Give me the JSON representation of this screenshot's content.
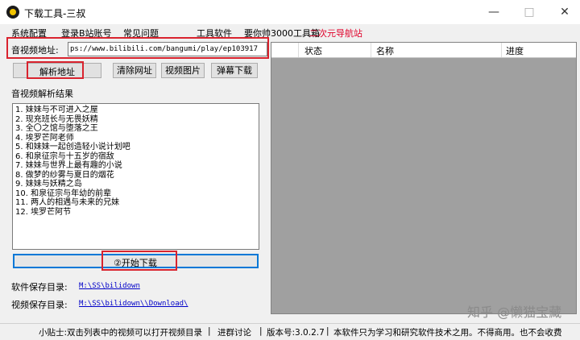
{
  "window": {
    "title": "下载工具-三叔",
    "minimize": "—",
    "maximize": "□",
    "close": "✕"
  },
  "menu": [
    "系统配置",
    "登录B站账号",
    "常见问题",
    "工具软件",
    "要你帅3000工具箱",
    "二次元导航站"
  ],
  "url_label": "音视频地址:",
  "url_value": "ps://www.bilibili.com/bangumi/play/ep103917",
  "buttons": {
    "parse": "解析地址",
    "clear": "清除网址",
    "video_pic": "视频图片",
    "danmaku": "弹幕下载",
    "start": "②开始下载"
  },
  "results_label": "音视频解析结果",
  "results": [
    "1. 妹妹与不可进入之屋",
    "2. 现充班长与无畏妖精",
    "3. 全〇之馆与堕落之王",
    "4. 埃罗芒阿老师",
    "5. 和妹妹一起创造轻小说计划吧",
    "6. 和泉征宗与十五岁的宿敌",
    "7. 妹妹与世界上最有趣的小说",
    "8. 做梦的纱雾与夏日的烟花",
    "9. 妹妹与妖精之岛",
    "10. 和泉征宗与年幼的前辈",
    "11. 两人的相遇与未来的兄妹",
    "12. 埃罗芒阿节"
  ],
  "table_headers": [
    "状态",
    "名称",
    "进度"
  ],
  "software_dir_label": "软件保存目录:",
  "software_dir_value": "M:\\SS\\bilidown",
  "video_dir_label": "视频保存目录:",
  "video_dir_value": "M:\\SS\\bilidown\\\\Download\\",
  "status": {
    "tip": "小贴士:双击列表中的视频可以打开视频目录",
    "group": "进群讨论",
    "version": "版本号:3.0.2.7",
    "notice": "本软件只为学习和研究软件技术之用。不得商用。也不会收费"
  },
  "watermark": "知乎 @懒猫宝藏"
}
